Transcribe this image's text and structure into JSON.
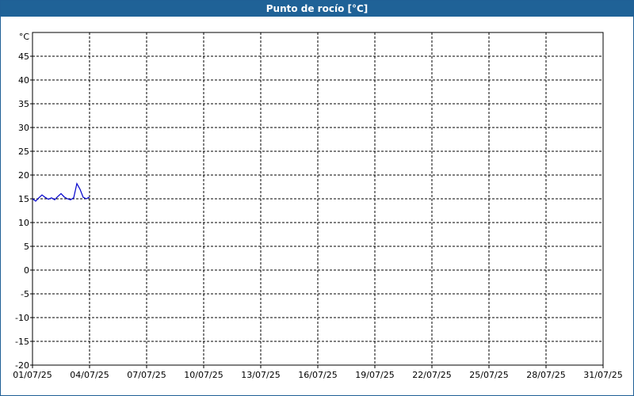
{
  "window": {
    "title": "Punto de rocío [°C]"
  },
  "chart_data": {
    "type": "line",
    "title": "Punto de rocío [°C]",
    "ylabel": "°C",
    "xlabel": "",
    "ylim": [
      -20,
      50
    ],
    "yticks": [
      -20,
      -15,
      -10,
      -5,
      0,
      5,
      10,
      15,
      20,
      25,
      30,
      35,
      40,
      45
    ],
    "xlim": [
      "01/07/25",
      "31/07/25"
    ],
    "xticks": [
      "01/07/25",
      "04/07/25",
      "07/07/25",
      "10/07/25",
      "13/07/25",
      "16/07/25",
      "19/07/25",
      "22/07/25",
      "25/07/25",
      "28/07/25",
      "31/07/25"
    ],
    "grid": true,
    "series_color": "#0000cc",
    "series": [
      {
        "x": [
          "01/07/25 00:00",
          "01/07/25 04:00",
          "01/07/25 08:00",
          "01/07/25 12:00",
          "01/07/25 16:00",
          "01/07/25 20:00",
          "02/07/25 00:00",
          "02/07/25 04:00",
          "02/07/25 08:00",
          "02/07/25 12:00",
          "02/07/25 16:00",
          "02/07/25 20:00",
          "03/07/25 00:00",
          "03/07/25 04:00",
          "03/07/25 08:00",
          "03/07/25 12:00",
          "03/07/25 16:00",
          "03/07/25 20:00",
          "04/07/25 00:00"
        ],
        "values": [
          15.0,
          14.5,
          15.2,
          15.8,
          15.3,
          14.9,
          15.2,
          14.8,
          15.5,
          16.1,
          15.4,
          15.0,
          14.8,
          15.2,
          18.2,
          17.0,
          15.3,
          15.0,
          15.4
        ]
      }
    ]
  }
}
